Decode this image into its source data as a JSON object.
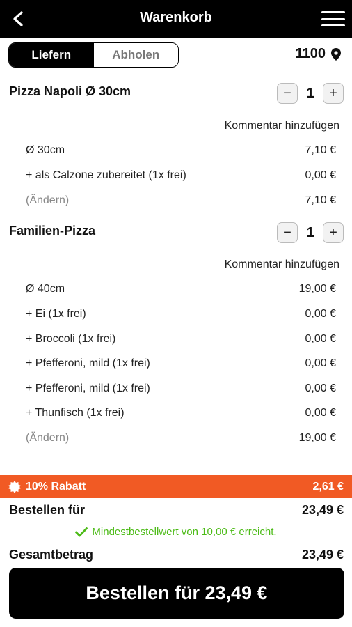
{
  "header": {
    "title": "Warenkorb"
  },
  "delivery": {
    "deliver_label": "Liefern",
    "pickup_label": "Abholen",
    "postal_code": "1100"
  },
  "items": [
    {
      "name": "Pizza Napoli Ø 30cm",
      "quantity": "1",
      "comment_label": "Kommentar hinzufügen",
      "lines": [
        {
          "label": "Ø 30cm",
          "price": "7,10 €"
        },
        {
          "label": "+ als Calzone zubereitet (1x frei)",
          "price": "0,00 €"
        },
        {
          "label": "(Ändern)",
          "price": "7,10 €"
        }
      ]
    },
    {
      "name": "Familien-Pizza",
      "quantity": "1",
      "comment_label": "Kommentar hinzufügen",
      "lines": [
        {
          "label": "Ø 40cm",
          "price": "19,00 €"
        },
        {
          "label": "+ Ei (1x frei)",
          "price": "0,00 €"
        },
        {
          "label": "+ Broccoli (1x frei)",
          "price": "0,00 €"
        },
        {
          "label": "+ Pfefferoni, mild (1x frei)",
          "price": "0,00 €"
        },
        {
          "label": "+ Pfefferoni, mild (1x frei)",
          "price": "0,00 €"
        },
        {
          "label": "+ Thunfisch (1x frei)",
          "price": "0,00 €"
        },
        {
          "label": "(Ändern)",
          "price": "19,00 €"
        }
      ]
    }
  ],
  "discount": {
    "label": "10% Rabatt",
    "amount": "2,61 €"
  },
  "order_for": {
    "label": "Bestellen für",
    "amount": "23,49 €"
  },
  "min_order_note": "Mindestbestellwert von 10,00 € erreicht.",
  "total": {
    "label": "Gesamtbetrag",
    "amount": "23,49 €"
  },
  "order_button": {
    "label": "Bestellen für 23,49 €"
  },
  "stepper": {
    "minus": "−",
    "plus": "+"
  },
  "colors": {
    "accent": "#f15a24",
    "success": "#4cbb17",
    "primary": "#000000"
  }
}
